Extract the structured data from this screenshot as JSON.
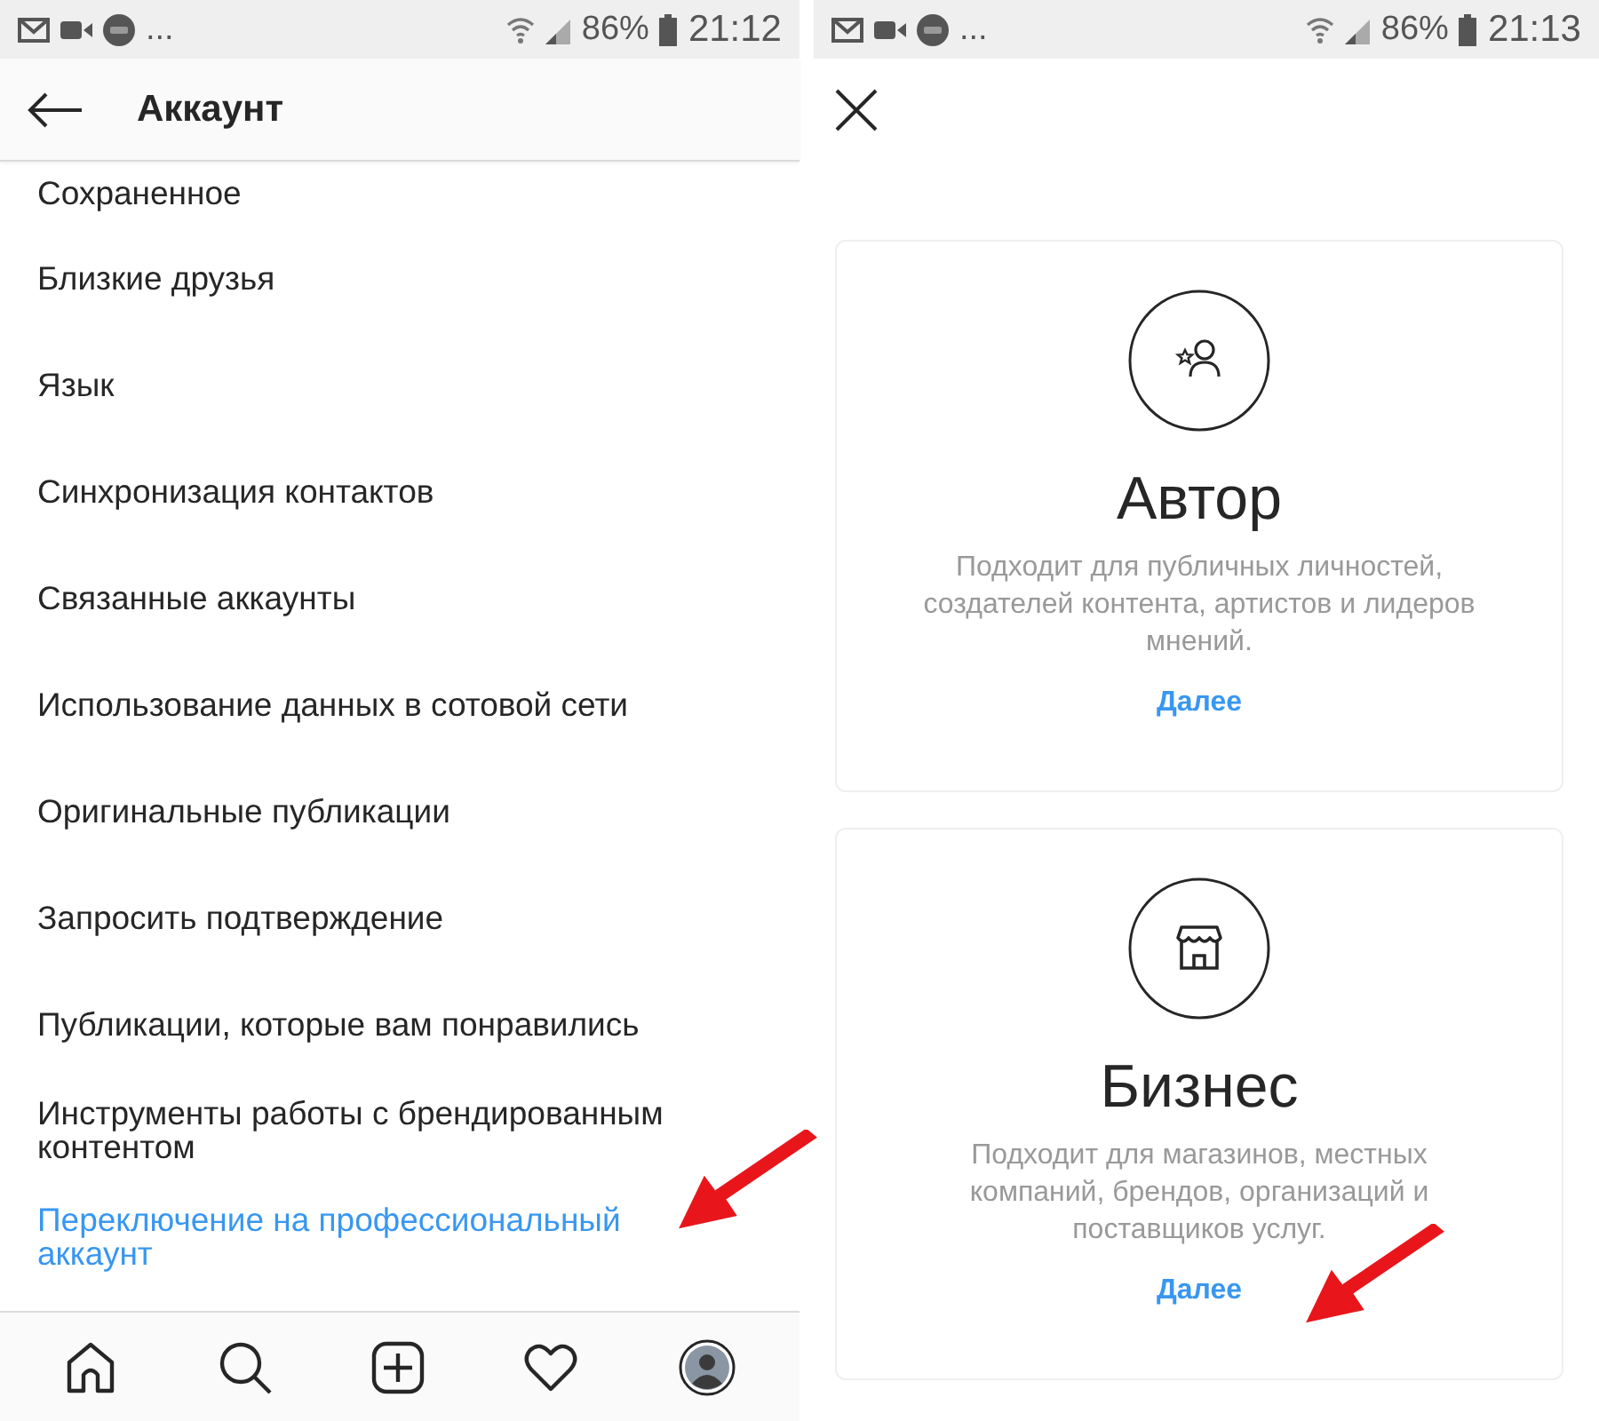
{
  "screens": [
    {
      "kind": "settings_list",
      "status_bar": {
        "more": "...",
        "battery": "86%",
        "time": "21:12"
      },
      "header": {
        "title": "Аккаунт"
      },
      "items": [
        {
          "label": "Сохраненное",
          "kind": "plain"
        },
        {
          "label": "Близкие друзья",
          "kind": "plain"
        },
        {
          "label": "Язык",
          "kind": "plain"
        },
        {
          "label": "Синхронизация контактов",
          "kind": "plain"
        },
        {
          "label": "Связанные аккаунты",
          "kind": "plain"
        },
        {
          "label": "Использование данных в сотовой сети",
          "kind": "plain"
        },
        {
          "label": "Оригинальные публикации",
          "kind": "plain"
        },
        {
          "label": "Запросить подтверждение",
          "kind": "plain"
        },
        {
          "label": "Публикации, которые вам понравились",
          "kind": "plain"
        },
        {
          "label": "Инструменты работы с брендированным контентом",
          "kind": "plain"
        },
        {
          "label": "Переключение на профессиональный аккаунт",
          "kind": "link"
        }
      ],
      "annotations": [
        {
          "kind": "arrow"
        }
      ],
      "nav": [
        {
          "kind": "home"
        },
        {
          "kind": "search"
        },
        {
          "kind": "add"
        },
        {
          "kind": "heart"
        },
        {
          "kind": "avatar"
        }
      ]
    },
    {
      "kind": "account_types",
      "status_bar": {
        "more": "...",
        "battery": "86%",
        "time": "21:13"
      },
      "cards": [
        {
          "title": "Автор",
          "description": "Подходит для публичных личностей, создателей контента, артистов и лидеров мнений.",
          "action": "Далее"
        },
        {
          "title": "Бизнес",
          "description": "Подходит для магазинов, местных компаний, брендов, организаций и поставщиков услуг.",
          "action": "Далее"
        }
      ],
      "annotations": [
        {
          "kind": "arrow"
        }
      ]
    }
  ]
}
